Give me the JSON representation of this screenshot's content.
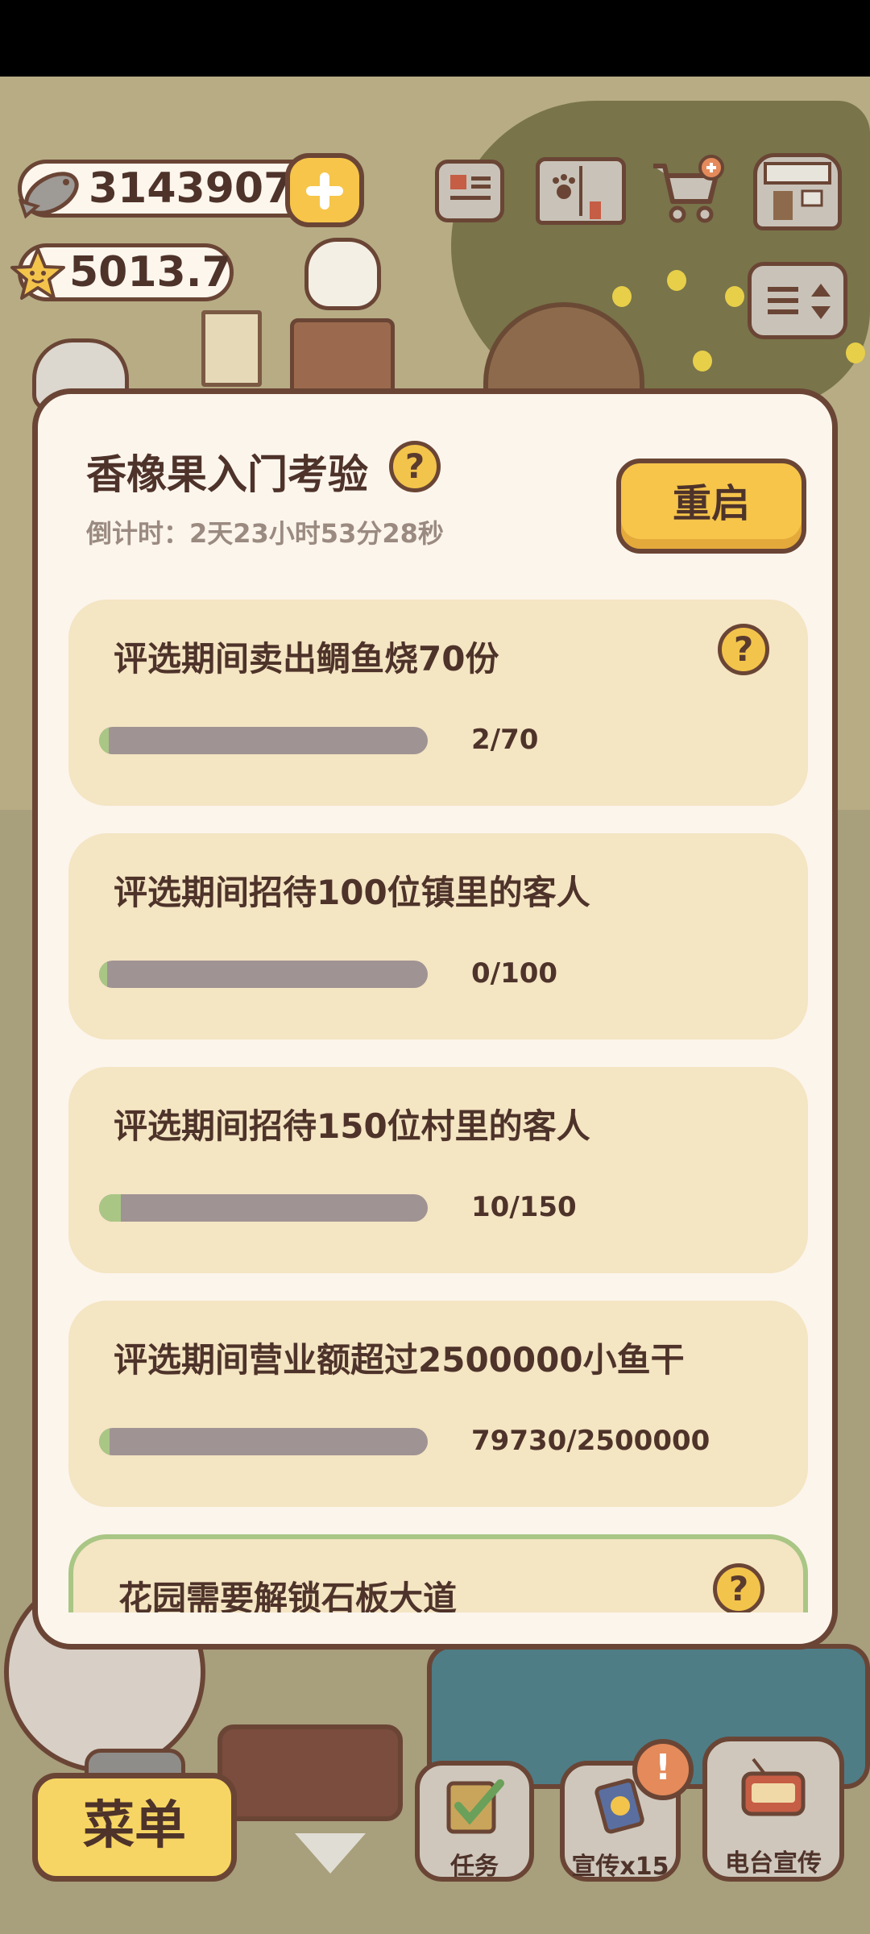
{
  "resources": {
    "fish_value": "3143907",
    "star_value": "5013.7"
  },
  "icons": {
    "fish": "fish-icon",
    "star": "star-icon",
    "plus": "plus-icon",
    "newspaper": "newspaper-icon",
    "book": "paw-book-icon",
    "cart": "fish-cart-icon",
    "shop": "shop-icon",
    "toggle": "toggle-list-icon",
    "help": "question-icon",
    "clipboard": "clipboard-check-icon",
    "promo": "promo-card-icon",
    "radio": "radio-icon",
    "alert": "exclamation-icon"
  },
  "modal": {
    "title": "香橡果入门考验",
    "help_glyph": "?",
    "countdown": "倒计时：2天23小时53分28秒",
    "restart_label": "重启"
  },
  "tasks": [
    {
      "text": "评选期间卖出鲷鱼烧70份",
      "progress_label": "2/70",
      "progress": 0.029,
      "has_help": true,
      "has_bar": true
    },
    {
      "text": "评选期间招待100位镇里的客人",
      "progress_label": "0/100",
      "progress": 0.0,
      "has_help": false,
      "has_bar": true
    },
    {
      "text": "评选期间招待150位村里的客人",
      "progress_label": "10/150",
      "progress": 0.067,
      "has_help": false,
      "has_bar": true
    },
    {
      "text": "评选期间营业额超过2500000小鱼干",
      "progress_label": "79730/2500000",
      "progress": 0.032,
      "has_help": false,
      "has_bar": true
    },
    {
      "text": "花园需要解锁石板大道",
      "has_help": true,
      "has_bar": false
    }
  ],
  "bottom": {
    "menu_label": "菜单",
    "task_label": "任务",
    "promo_label": "宣传x15",
    "radio_label": "电台宣传",
    "alert_glyph": "!"
  },
  "colors": {
    "accent_yellow": "#f6c54a",
    "outline_brown": "#6a4535",
    "progress_green": "#a9c685",
    "progress_track": "#9f9393",
    "card_bg": "#f4e5c3",
    "modal_bg": "#fcf5ec"
  }
}
